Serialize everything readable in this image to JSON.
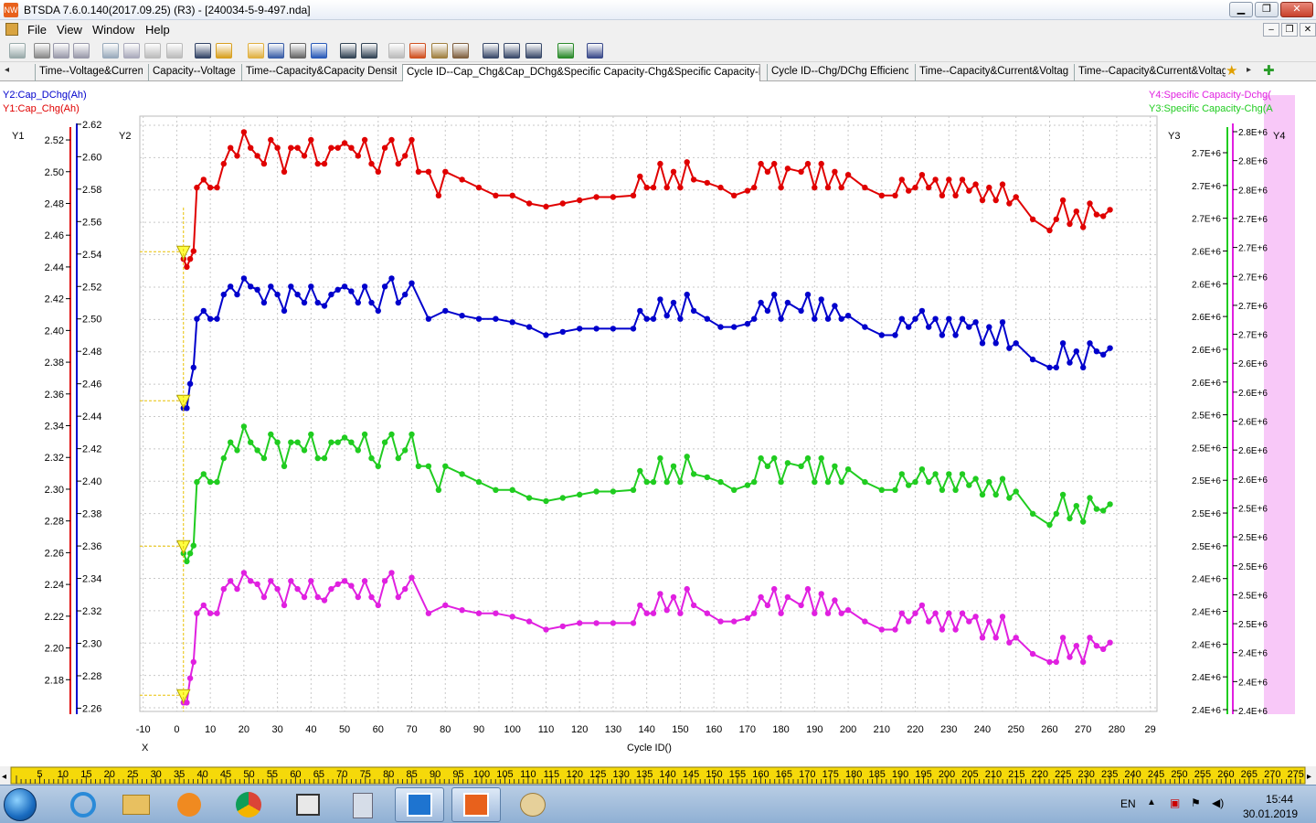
{
  "window": {
    "title": "BTSDA 7.6.0.140(2017.09.25) (R3) - [240034-5-9-497.nda]",
    "app_icon": "NW"
  },
  "menu": [
    "File",
    "View",
    "Window",
    "Help"
  ],
  "tabs": [
    "Time--Voltage&Current",
    "Capacity--Voltage",
    "Time--Capacity&Capacity Density",
    "Cycle ID--Cap_Chg&Cap_DChg&Specific Capacity-Chg&Specific Capacity-Dchg",
    "Cycle ID--Chg/DChg Efficiency",
    "Time--Capacity&Current&Voltage",
    "Time--Capacity&Current&Voltage"
  ],
  "toolbar_icons": [
    "hand-icon",
    "pointer-icon",
    "zoom-in-icon",
    "zoom-out-icon",
    "table-icon",
    "copy-icon",
    "undo-icon",
    "redo-icon",
    "line-icon",
    "filter-icon",
    "open-folder-icon",
    "save-icon",
    "print-icon",
    "help-icon",
    "back-icon",
    "forward-icon",
    "language-icon",
    "marker-icon",
    "config-icon",
    "settings-icon",
    "grid-icon",
    "list-icon",
    "layout-icon",
    "excel-icon",
    "chart-export-icon"
  ],
  "chart_data": {
    "type": "scatter",
    "x_label": "Cycle ID()",
    "x_axis_name": "X",
    "x_ticks": [
      -10,
      0,
      10,
      20,
      30,
      40,
      50,
      60,
      70,
      80,
      90,
      100,
      110,
      120,
      130,
      140,
      150,
      160,
      170,
      180,
      190,
      200,
      210,
      220,
      230,
      240,
      250,
      260,
      270,
      280,
      29
    ],
    "xlim": [
      -11,
      292
    ],
    "y1": {
      "name": "Y1",
      "label": "Y1:Cap_Chg(Ah)",
      "color": "#e00000",
      "ylim": [
        2.16,
        2.535
      ],
      "ticks": [
        "2.52",
        "2.50",
        "2.48",
        "2.46",
        "2.44",
        "2.42",
        "2.40",
        "2.38",
        "2.36",
        "2.34",
        "2.32",
        "2.30",
        "2.28",
        "2.26",
        "2.24",
        "2.22",
        "2.20",
        "2.18"
      ]
    },
    "y2": {
      "name": "Y2",
      "label": "Y2:Cap_DChg(Ah)",
      "color": "#0000cc",
      "ylim": [
        2.258,
        2.625
      ],
      "ticks": [
        "2.62",
        "2.60",
        "2.58",
        "2.56",
        "2.54",
        "2.52",
        "2.50",
        "2.48",
        "2.46",
        "2.44",
        "2.42",
        "2.40",
        "2.38",
        "2.36",
        "2.34",
        "2.32",
        "2.30",
        "2.28",
        "2.26"
      ]
    },
    "y3": {
      "name": "Y3",
      "label": "Y3:Specific Capacity-Chg(A",
      "color": "#20cc20",
      "ticks": [
        "2.7E+6",
        "2.7E+6",
        "2.7E+6",
        "2.6E+6",
        "2.6E+6",
        "2.6E+6",
        "2.6E+6",
        "2.6E+6",
        "2.5E+6",
        "2.5E+6",
        "2.5E+6",
        "2.5E+6",
        "2.5E+6",
        "2.4E+6",
        "2.4E+6",
        "2.4E+6",
        "2.4E+6",
        "2.4E+6"
      ]
    },
    "y4": {
      "name": "Y4",
      "label": "Y4:Specific Capacity-Dchg(",
      "color": "#e020e0",
      "ticks": [
        "2.8E+6",
        "2.8E+6",
        "2.8E+6",
        "2.7E+6",
        "2.7E+6",
        "2.7E+6",
        "2.7E+6",
        "2.7E+6",
        "2.6E+6",
        "2.6E+6",
        "2.6E+6",
        "2.6E+6",
        "2.6E+6",
        "2.5E+6",
        "2.5E+6",
        "2.5E+6",
        "2.5E+6",
        "2.5E+6",
        "2.4E+6",
        "2.4E+6",
        "2.4E+6"
      ]
    },
    "series": [
      {
        "name": "Y1:Cap_Chg(Ah)",
        "axis": "y1",
        "color": "#e00000",
        "x": [
          2,
          3,
          4,
          5,
          6,
          8,
          10,
          12,
          14,
          16,
          18,
          20,
          22,
          24,
          26,
          28,
          30,
          32,
          34,
          36,
          38,
          40,
          42,
          44,
          46,
          48,
          50,
          52,
          54,
          56,
          58,
          60,
          62,
          64,
          66,
          68,
          70,
          72,
          75,
          78,
          80,
          85,
          90,
          95,
          100,
          105,
          110,
          115,
          120,
          125,
          130,
          136,
          138,
          140,
          142,
          144,
          146,
          148,
          150,
          152,
          154,
          158,
          162,
          166,
          170,
          172,
          174,
          176,
          178,
          180,
          182,
          186,
          188,
          190,
          192,
          194,
          196,
          198,
          200,
          205,
          210,
          214,
          216,
          218,
          220,
          222,
          224,
          226,
          228,
          230,
          232,
          234,
          236,
          238,
          240,
          242,
          244,
          246,
          248,
          250,
          255,
          260,
          262,
          264,
          266,
          268,
          270,
          272,
          274,
          276,
          278
        ],
        "y": [
          2.445,
          2.44,
          2.445,
          2.45,
          2.49,
          2.495,
          2.49,
          2.49,
          2.505,
          2.515,
          2.51,
          2.525,
          2.515,
          2.51,
          2.505,
          2.52,
          2.515,
          2.5,
          2.515,
          2.515,
          2.51,
          2.52,
          2.505,
          2.505,
          2.515,
          2.515,
          2.518,
          2.515,
          2.51,
          2.52,
          2.505,
          2.5,
          2.515,
          2.52,
          2.505,
          2.51,
          2.52,
          2.5,
          2.5,
          2.485,
          2.5,
          2.495,
          2.49,
          2.485,
          2.485,
          2.48,
          2.478,
          2.48,
          2.482,
          2.484,
          2.484,
          2.485,
          2.497,
          2.49,
          2.49,
          2.505,
          2.49,
          2.5,
          2.49,
          2.506,
          2.495,
          2.493,
          2.49,
          2.485,
          2.488,
          2.49,
          2.505,
          2.5,
          2.505,
          2.49,
          2.502,
          2.5,
          2.505,
          2.49,
          2.505,
          2.49,
          2.5,
          2.49,
          2.498,
          2.49,
          2.485,
          2.485,
          2.495,
          2.488,
          2.49,
          2.498,
          2.49,
          2.495,
          2.485,
          2.495,
          2.485,
          2.495,
          2.488,
          2.492,
          2.482,
          2.49,
          2.482,
          2.492,
          2.48,
          2.484,
          2.47,
          2.463,
          2.47,
          2.482,
          2.467,
          2.475,
          2.465,
          2.48,
          2.473,
          2.472,
          2.476
        ]
      },
      {
        "name": "Y2:Cap_DChg(Ah)",
        "axis": "y2",
        "color": "#0000cc",
        "x": [
          2,
          3,
          4,
          5,
          6,
          8,
          10,
          12,
          14,
          16,
          18,
          20,
          22,
          24,
          26,
          28,
          30,
          32,
          34,
          36,
          38,
          40,
          42,
          44,
          46,
          48,
          50,
          52,
          54,
          56,
          58,
          60,
          62,
          64,
          66,
          68,
          70,
          75,
          80,
          85,
          90,
          95,
          100,
          105,
          110,
          115,
          120,
          125,
          130,
          136,
          138,
          140,
          142,
          144,
          146,
          148,
          150,
          152,
          154,
          158,
          162,
          166,
          170,
          172,
          174,
          176,
          178,
          180,
          182,
          186,
          188,
          190,
          192,
          194,
          196,
          198,
          200,
          205,
          210,
          214,
          216,
          218,
          220,
          222,
          224,
          226,
          228,
          230,
          232,
          234,
          236,
          238,
          240,
          242,
          244,
          246,
          248,
          250,
          255,
          260,
          262,
          264,
          266,
          268,
          270,
          272,
          274,
          276,
          278
        ],
        "y": [
          2.445,
          2.445,
          2.46,
          2.47,
          2.5,
          2.505,
          2.5,
          2.5,
          2.515,
          2.52,
          2.515,
          2.525,
          2.52,
          2.518,
          2.51,
          2.52,
          2.515,
          2.505,
          2.52,
          2.515,
          2.51,
          2.52,
          2.51,
          2.508,
          2.515,
          2.518,
          2.52,
          2.517,
          2.51,
          2.52,
          2.51,
          2.505,
          2.52,
          2.525,
          2.51,
          2.515,
          2.522,
          2.5,
          2.505,
          2.502,
          2.5,
          2.5,
          2.498,
          2.495,
          2.49,
          2.492,
          2.494,
          2.494,
          2.494,
          2.494,
          2.505,
          2.5,
          2.5,
          2.512,
          2.502,
          2.51,
          2.5,
          2.515,
          2.505,
          2.5,
          2.495,
          2.495,
          2.497,
          2.5,
          2.51,
          2.505,
          2.515,
          2.5,
          2.51,
          2.505,
          2.515,
          2.5,
          2.512,
          2.5,
          2.508,
          2.5,
          2.502,
          2.495,
          2.49,
          2.49,
          2.5,
          2.495,
          2.5,
          2.505,
          2.495,
          2.5,
          2.49,
          2.5,
          2.49,
          2.5,
          2.495,
          2.498,
          2.485,
          2.495,
          2.485,
          2.498,
          2.482,
          2.485,
          2.475,
          2.47,
          2.47,
          2.485,
          2.473,
          2.48,
          2.47,
          2.485,
          2.48,
          2.478,
          2.482
        ]
      }
    ],
    "series_secondary": [
      {
        "name": "Y3:Specific Capacity-Chg(A",
        "color": "#20cc20"
      },
      {
        "name": "Y4:Specific Capacity-Dchg(",
        "color": "#e020e0"
      }
    ],
    "grid": true,
    "legend": "top-left and top-right"
  },
  "ruler_ticks": [
    "5",
    "10",
    "15",
    "20",
    "25",
    "30",
    "35",
    "40",
    "45",
    "50",
    "55",
    "60",
    "65",
    "70",
    "75",
    "80",
    "85",
    "90",
    "95",
    "100",
    "105",
    "110",
    "115",
    "120",
    "125",
    "130",
    "135",
    "140",
    "145",
    "150",
    "155",
    "160",
    "165",
    "170",
    "175",
    "180",
    "185",
    "190",
    "195",
    "200",
    "205",
    "210",
    "215",
    "220",
    "225",
    "230",
    "235",
    "240",
    "245",
    "250",
    "255",
    "260",
    "265",
    "270",
    "275"
  ],
  "taskbar": {
    "icons": [
      "start-icon",
      "ie-icon",
      "explorer-icon",
      "media-icon",
      "chrome-icon",
      "box-icon",
      "calculator-icon",
      "btsda-icon",
      "btsda-icon",
      "paint-icon"
    ],
    "lang": "EN",
    "time": "15:44",
    "date": "30.01.2019"
  }
}
